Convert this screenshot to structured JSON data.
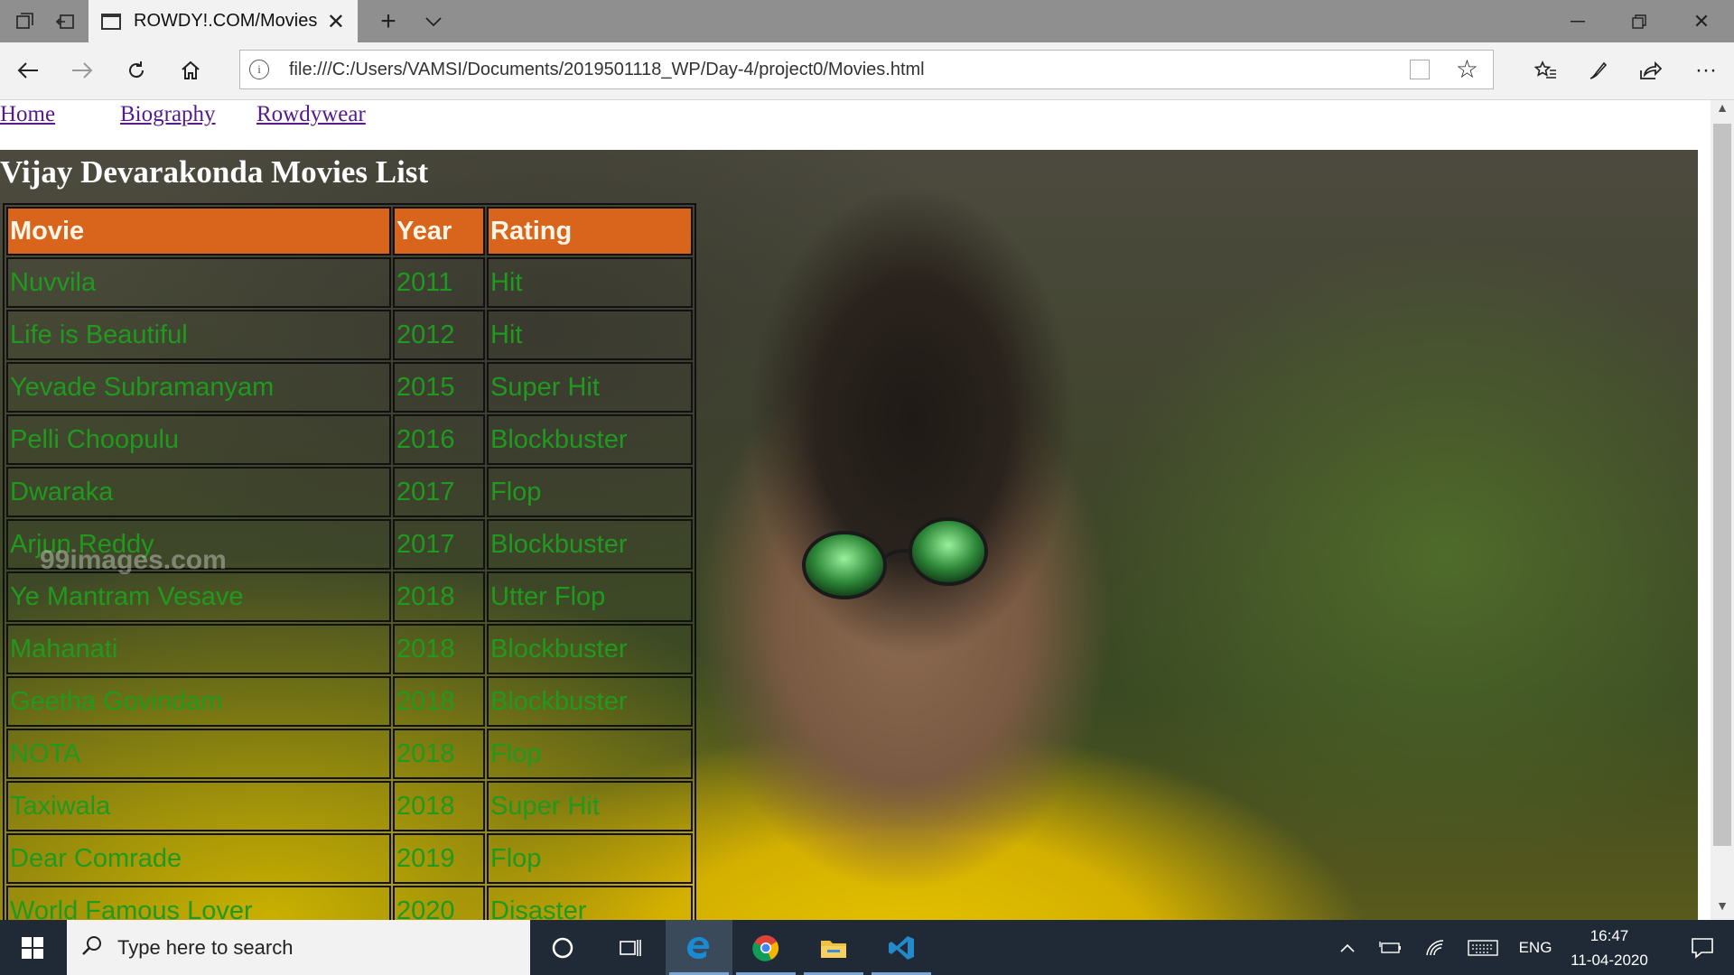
{
  "browser": {
    "tab_title": "ROWDY!.COM/Movies",
    "url": "file:///C:/Users/VAMSI/Documents/2019501118_WP/Day-4/project0/Movies.html"
  },
  "page": {
    "nav": [
      "Home",
      "Biography",
      "Rowdywear"
    ],
    "heading": "Vijay Devarakonda Movies List",
    "watermark": "99images.com",
    "table": {
      "headers": [
        "Movie",
        "Year",
        "Rating"
      ],
      "rows": [
        [
          "Nuvvila",
          "2011",
          "Hit"
        ],
        [
          "Life is Beautiful",
          "2012",
          "Hit"
        ],
        [
          "Yevade Subramanyam",
          "2015",
          "Super Hit"
        ],
        [
          "Pelli Choopulu",
          "2016",
          "Blockbuster"
        ],
        [
          "Dwaraka",
          "2017",
          "Flop"
        ],
        [
          "Arjun Reddy",
          "2017",
          "Blockbuster"
        ],
        [
          "Ye Mantram Vesave",
          "2018",
          "Utter Flop"
        ],
        [
          "Mahanati",
          "2018",
          "Blockbuster"
        ],
        [
          "Geetha Govindam",
          "2018",
          "Blockbuster"
        ],
        [
          "NOTA",
          "2018",
          "Flop"
        ],
        [
          "Taxiwala",
          "2018",
          "Super Hit"
        ],
        [
          "Dear Comrade",
          "2019",
          "Flop"
        ],
        [
          "World Famous Lover",
          "2020",
          "Disaster"
        ]
      ]
    }
  },
  "taskbar": {
    "search_placeholder": "Type here to search",
    "language": "ENG",
    "time": "16:47",
    "date": "11-04-2020"
  },
  "colors": {
    "header_bg": "#d9641c",
    "cell_text": "#1f9a1f",
    "link": "#551a8b",
    "taskbar_bg": "#1f2a36"
  }
}
